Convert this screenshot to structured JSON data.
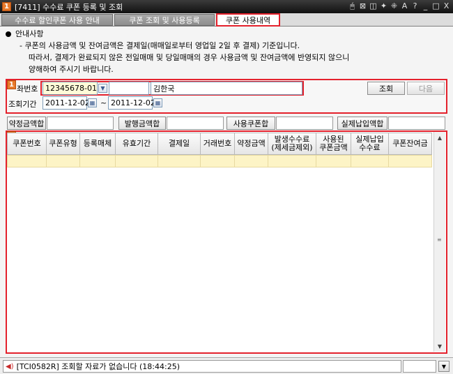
{
  "window": {
    "badge": "1",
    "title": "[7411] 수수료 쿠폰 등록 및 조회",
    "controls": [
      "🖱",
      "⊠",
      "◫",
      "✦",
      "⁜",
      "A",
      "?",
      "_",
      "□",
      "X"
    ]
  },
  "tabs": [
    {
      "label": "수수료 할인쿠폰 사용 안내"
    },
    {
      "label": "쿠폰 조회 및 사용등록"
    },
    {
      "label": "쿠폰 사용내역"
    }
  ],
  "notice": {
    "heading": "안내사항",
    "line1": "- 쿠폰의 사용금액 및 잔여금액은 결제일(매매일로부터 영업일 2일 후 결제) 기준입니다.",
    "line2": "따라서, 결제가 완료되지 않은 전일매매 및 당일매매의 경우 사용금액 및 잔여금액에 반영되지 않으니",
    "line3": "양해하여 주시기 바랍니다."
  },
  "search": {
    "badge": "1",
    "account_label": "좌번호",
    "account_value": "12345678-01",
    "account_extra": "",
    "name_value": "김한국",
    "period_label": "조회기간",
    "date_from": "2011-12-02",
    "date_sep": "~",
    "date_to": "2011-12-02",
    "query_button": "조회",
    "next_button": "다음"
  },
  "sums": {
    "contract_label": "약정금액합",
    "issued_label": "발행금액합",
    "coupon_label": "사용쿠폰합",
    "paid_label": "실제납입액합"
  },
  "grid": {
    "badge": "2",
    "columns": [
      "쿠폰번호",
      "쿠폰유형",
      "등록매체",
      "유효기간",
      "결제일",
      "거래번호",
      "약정금액",
      "발생수수료\n(제세금제외)",
      "사용된\n쿠폰금액",
      "실제납입\n수수료",
      "쿠폰잔여금"
    ]
  },
  "status": {
    "message": "[TCI0582R] 조회할 자료가 없습니다 (18:44:25)"
  },
  "colors": {
    "accent_red": "#e4212c",
    "badge_orange": "#e8792a",
    "row_highlight": "#fdf4c6"
  }
}
